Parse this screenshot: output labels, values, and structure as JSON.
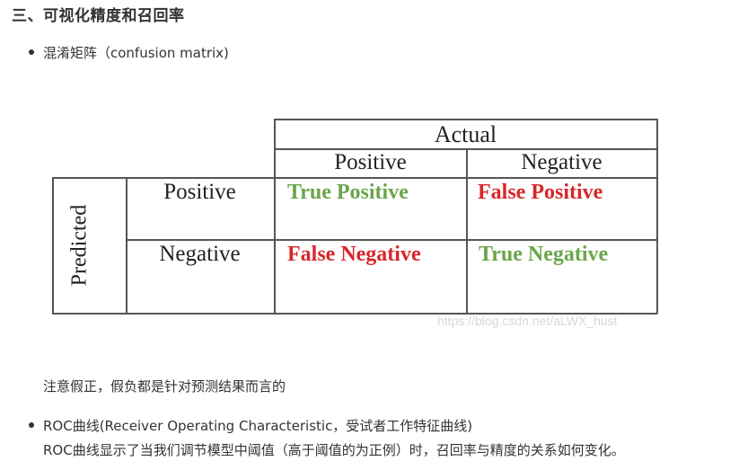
{
  "heading": "三、可视化精度和召回率",
  "bullet1": "混淆矩阵（confusion matrix)",
  "matrix": {
    "actual_label": "Actual",
    "predicted_label": "Predicted",
    "col_positive": "Positive",
    "col_negative": "Negative",
    "row_positive": "Positive",
    "row_negative": "Negative",
    "cell_tp": "True Positive",
    "cell_fp": "False Positive",
    "cell_fn": "False Negative",
    "cell_tn": "True Negative",
    "true_color": "#6aa54a",
    "false_color": "#d9262b",
    "watermark": "https://blog.csdn.net/aLWX_hust"
  },
  "note": "注意假正，假负都是针对预测结果而言的",
  "bullet2": "ROC曲线(Receiver Operating Characteristic，受试者工作特征曲线)",
  "bullet2_line2": "ROC曲线显示了当我们调节模型中阈值（高于阈值的为正例）时，召回率与精度的关系如何变化。"
}
